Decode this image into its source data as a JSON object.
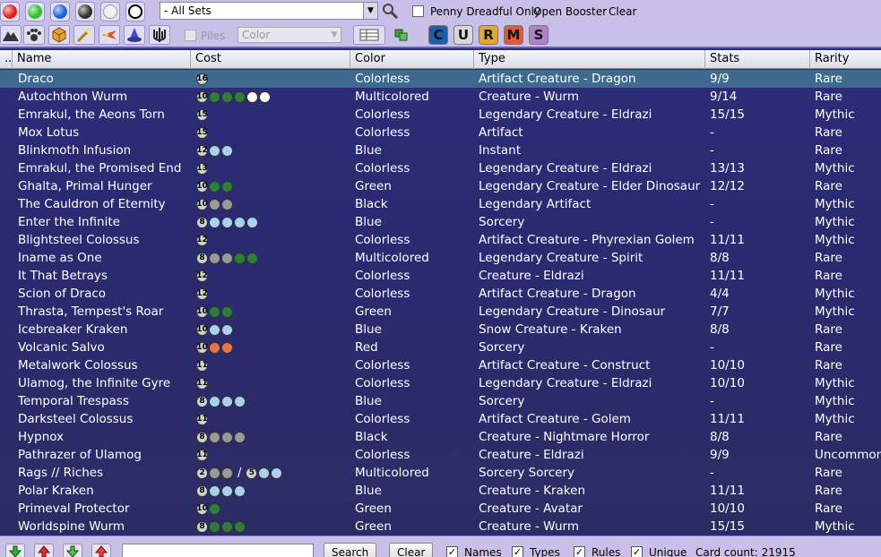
{
  "toolbar": {
    "color_filters": [
      {
        "name": "red-mana-icon",
        "color": "#e02020"
      },
      {
        "name": "green-mana-icon",
        "color": "#30c030"
      },
      {
        "name": "blue-mana-icon",
        "color": "#2060e0"
      },
      {
        "name": "black-mana-icon",
        "color": "#333333"
      },
      {
        "name": "white-mana-icon",
        "color": "#f0f0f0"
      },
      {
        "name": "colorless-mana-icon",
        "color": "#ffffff"
      }
    ],
    "sets_select_value": "- All Sets",
    "penny_dreadful_label": "Penny Dreadful Only",
    "open_booster_label": "Open Booster",
    "clear_label": "Clear",
    "piles_label": "Piles",
    "color_sort_value": "Color",
    "rarity_buttons": [
      {
        "label": "C",
        "bg": "#1d5fa8",
        "fg": "#111"
      },
      {
        "label": "U",
        "bg": "#d8d8d8",
        "fg": "#111"
      },
      {
        "label": "R",
        "bg": "#e2a72c",
        "fg": "#111"
      },
      {
        "label": "M",
        "bg": "#e05a3a",
        "fg": "#111"
      },
      {
        "label": "S",
        "bg": "#b080c8",
        "fg": "#111"
      }
    ]
  },
  "table": {
    "columns": [
      "Name",
      "Cost",
      "Color",
      "Type",
      "Stats",
      "Rarity"
    ],
    "rows": [
      {
        "name": "Draco",
        "cost": [
          [
            "16",
            "C"
          ]
        ],
        "color": "Colorless",
        "type": "Artifact Creature  - Dragon",
        "stats": "9/9",
        "rarity": "Rare",
        "selected": true
      },
      {
        "name": "Autochthon Wurm",
        "cost": [
          [
            "10",
            "C"
          ],
          [
            "",
            "G"
          ],
          [
            "",
            "G"
          ],
          [
            "",
            "G"
          ],
          [
            "",
            "W"
          ],
          [
            "",
            "W"
          ]
        ],
        "color": "Multicolored",
        "type": "Creature  - Wurm",
        "stats": "9/14",
        "rarity": "Rare"
      },
      {
        "name": "Emrakul, the Aeons Torn",
        "cost": [
          [
            "15",
            "C"
          ]
        ],
        "color": "Colorless",
        "type": "Legendary Creature  - Eldrazi",
        "stats": "15/15",
        "rarity": "Mythic"
      },
      {
        "name": "Mox Lotus",
        "cost": [
          [
            "15",
            "C"
          ]
        ],
        "color": "Colorless",
        "type": "Artifact",
        "stats": "-",
        "rarity": "Rare"
      },
      {
        "name": "Blinkmoth Infusion",
        "cost": [
          [
            "12",
            "C"
          ],
          [
            "",
            "U"
          ],
          [
            "",
            "U"
          ]
        ],
        "color": "Blue",
        "type": "Instant",
        "stats": "-",
        "rarity": "Rare"
      },
      {
        "name": "Emrakul, the Promised End",
        "cost": [
          [
            "13",
            "C"
          ]
        ],
        "color": "Colorless",
        "type": "Legendary Creature  - Eldrazi",
        "stats": "13/13",
        "rarity": "Mythic"
      },
      {
        "name": "Ghalta, Primal Hunger",
        "cost": [
          [
            "10",
            "C"
          ],
          [
            "",
            "G"
          ],
          [
            "",
            "G"
          ]
        ],
        "color": "Green",
        "type": "Legendary Creature  - Elder Dinosaur",
        "stats": "12/12",
        "rarity": "Rare"
      },
      {
        "name": "The Cauldron of Eternity",
        "cost": [
          [
            "10",
            "C"
          ],
          [
            "",
            "B"
          ],
          [
            "",
            "B"
          ]
        ],
        "color": "Black",
        "type": "Legendary Artifact",
        "stats": "-",
        "rarity": "Mythic"
      },
      {
        "name": "Enter the Infinite",
        "cost": [
          [
            "8",
            "C"
          ],
          [
            "",
            "U"
          ],
          [
            "",
            "U"
          ],
          [
            "",
            "U"
          ],
          [
            "",
            "U"
          ]
        ],
        "color": "Blue",
        "type": "Sorcery",
        "stats": "-",
        "rarity": "Mythic"
      },
      {
        "name": "Blightsteel Colossus",
        "cost": [
          [
            "12",
            "C"
          ]
        ],
        "color": "Colorless",
        "type": "Artifact Creature  - Phyrexian Golem",
        "stats": "11/11",
        "rarity": "Mythic"
      },
      {
        "name": "Iname as One",
        "cost": [
          [
            "8",
            "C"
          ],
          [
            "",
            "B"
          ],
          [
            "",
            "B"
          ],
          [
            "",
            "G"
          ],
          [
            "",
            "G"
          ]
        ],
        "color": "Multicolored",
        "type": "Legendary Creature  - Spirit",
        "stats": "8/8",
        "rarity": "Rare"
      },
      {
        "name": "It That Betrays",
        "cost": [
          [
            "12",
            "C"
          ]
        ],
        "color": "Colorless",
        "type": "Creature  - Eldrazi",
        "stats": "11/11",
        "rarity": "Rare"
      },
      {
        "name": "Scion of Draco",
        "cost": [
          [
            "12",
            "C"
          ]
        ],
        "color": "Colorless",
        "type": "Artifact Creature  - Dragon",
        "stats": "4/4",
        "rarity": "Mythic"
      },
      {
        "name": "Thrasta, Tempest's Roar",
        "cost": [
          [
            "10",
            "C"
          ],
          [
            "",
            "G"
          ],
          [
            "",
            "G"
          ]
        ],
        "color": "Green",
        "type": "Legendary Creature  - Dinosaur",
        "stats": "7/7",
        "rarity": "Mythic"
      },
      {
        "name": "Icebreaker Kraken",
        "cost": [
          [
            "10",
            "C"
          ],
          [
            "",
            "U"
          ],
          [
            "",
            "U"
          ]
        ],
        "color": "Blue",
        "type": "Snow Creature  - Kraken",
        "stats": "8/8",
        "rarity": "Rare"
      },
      {
        "name": "Volcanic Salvo",
        "cost": [
          [
            "10",
            "C"
          ],
          [
            "",
            "R"
          ],
          [
            "",
            "R"
          ]
        ],
        "color": "Red",
        "type": "Sorcery",
        "stats": "-",
        "rarity": "Rare"
      },
      {
        "name": "Metalwork Colossus",
        "cost": [
          [
            "11",
            "C"
          ]
        ],
        "color": "Colorless",
        "type": "Artifact Creature  - Construct",
        "stats": "10/10",
        "rarity": "Rare"
      },
      {
        "name": "Ulamog, the Infinite Gyre",
        "cost": [
          [
            "11",
            "C"
          ]
        ],
        "color": "Colorless",
        "type": "Legendary Creature  - Eldrazi",
        "stats": "10/10",
        "rarity": "Mythic"
      },
      {
        "name": "Temporal Trespass",
        "cost": [
          [
            "8",
            "C"
          ],
          [
            "",
            "U"
          ],
          [
            "",
            "U"
          ],
          [
            "",
            "U"
          ]
        ],
        "color": "Blue",
        "type": "Sorcery",
        "stats": "-",
        "rarity": "Mythic"
      },
      {
        "name": "Darksteel Colossus",
        "cost": [
          [
            "11",
            "C"
          ]
        ],
        "color": "Colorless",
        "type": "Artifact Creature  - Golem",
        "stats": "11/11",
        "rarity": "Mythic"
      },
      {
        "name": "Hypnox",
        "cost": [
          [
            "8",
            "C"
          ],
          [
            "",
            "B"
          ],
          [
            "",
            "B"
          ],
          [
            "",
            "B"
          ]
        ],
        "color": "Black",
        "type": "Creature  - Nightmare Horror",
        "stats": "8/8",
        "rarity": "Rare"
      },
      {
        "name": "Pathrazer of Ulamog",
        "cost": [
          [
            "11",
            "C"
          ]
        ],
        "color": "Colorless",
        "type": "Creature  - Eldrazi",
        "stats": "9/9",
        "rarity": "Uncommon"
      },
      {
        "name": "Rags // Riches",
        "cost": [
          [
            "2",
            "C"
          ],
          [
            "",
            "B"
          ],
          [
            "",
            "B"
          ],
          [
            "/",
            "SEP"
          ],
          [
            "5",
            "C"
          ],
          [
            "",
            "U"
          ],
          [
            "",
            "U"
          ]
        ],
        "color": "Multicolored",
        "type": "Sorcery Sorcery",
        "stats": "-",
        "rarity": "Rare"
      },
      {
        "name": "Polar Kraken",
        "cost": [
          [
            "8",
            "C"
          ],
          [
            "",
            "U"
          ],
          [
            "",
            "U"
          ],
          [
            "",
            "U"
          ]
        ],
        "color": "Blue",
        "type": "Creature  - Kraken",
        "stats": "11/11",
        "rarity": "Rare"
      },
      {
        "name": "Primeval Protector",
        "cost": [
          [
            "10",
            "C"
          ],
          [
            "",
            "G"
          ]
        ],
        "color": "Green",
        "type": "Creature  - Avatar",
        "stats": "10/10",
        "rarity": "Rare"
      },
      {
        "name": "Worldspine Wurm",
        "cost": [
          [
            "8",
            "C"
          ],
          [
            "",
            "G"
          ],
          [
            "",
            "G"
          ],
          [
            "",
            "G"
          ]
        ],
        "color": "Green",
        "type": "Creature  - Wurm",
        "stats": "15/15",
        "rarity": "Mythic"
      }
    ]
  },
  "bottom": {
    "search_button": "Search",
    "clear_button": "Clear",
    "checks": [
      "Names",
      "Types",
      "Rules",
      "Unique"
    ],
    "card_count": "Card count: 21915"
  }
}
